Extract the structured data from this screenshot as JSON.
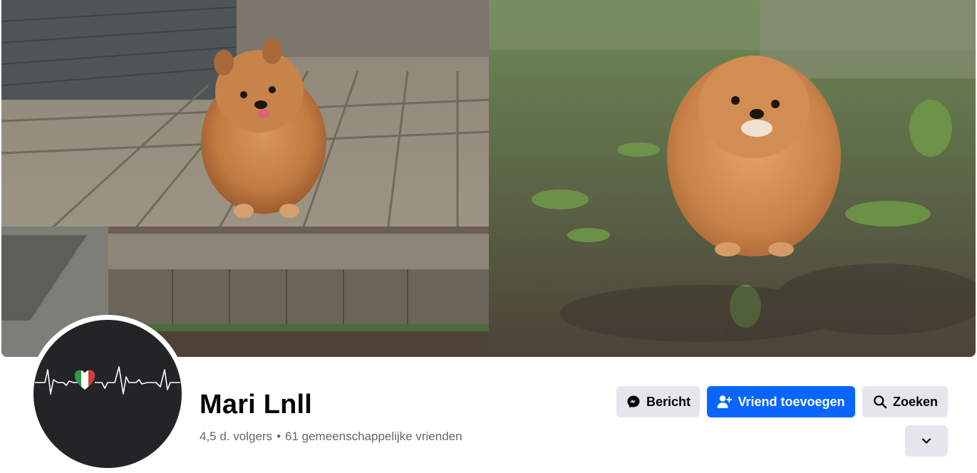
{
  "profile": {
    "name": "Mari Lnll",
    "followers": "4,5 d. volgers",
    "separator": "•",
    "mutual_friends": "61 gemeenschappelijke vrienden"
  },
  "actions": {
    "message_label": "Bericht",
    "add_friend_label": "Vriend toevoegen",
    "search_label": "Zoeken"
  },
  "icons": {
    "message": "messenger-icon",
    "add_friend": "person-add-icon",
    "search": "search-icon",
    "more": "chevron-down-icon"
  },
  "colors": {
    "primary_button": "#0866ff",
    "secondary_button": "#e4e6eb",
    "avatar_background": "#232426"
  }
}
